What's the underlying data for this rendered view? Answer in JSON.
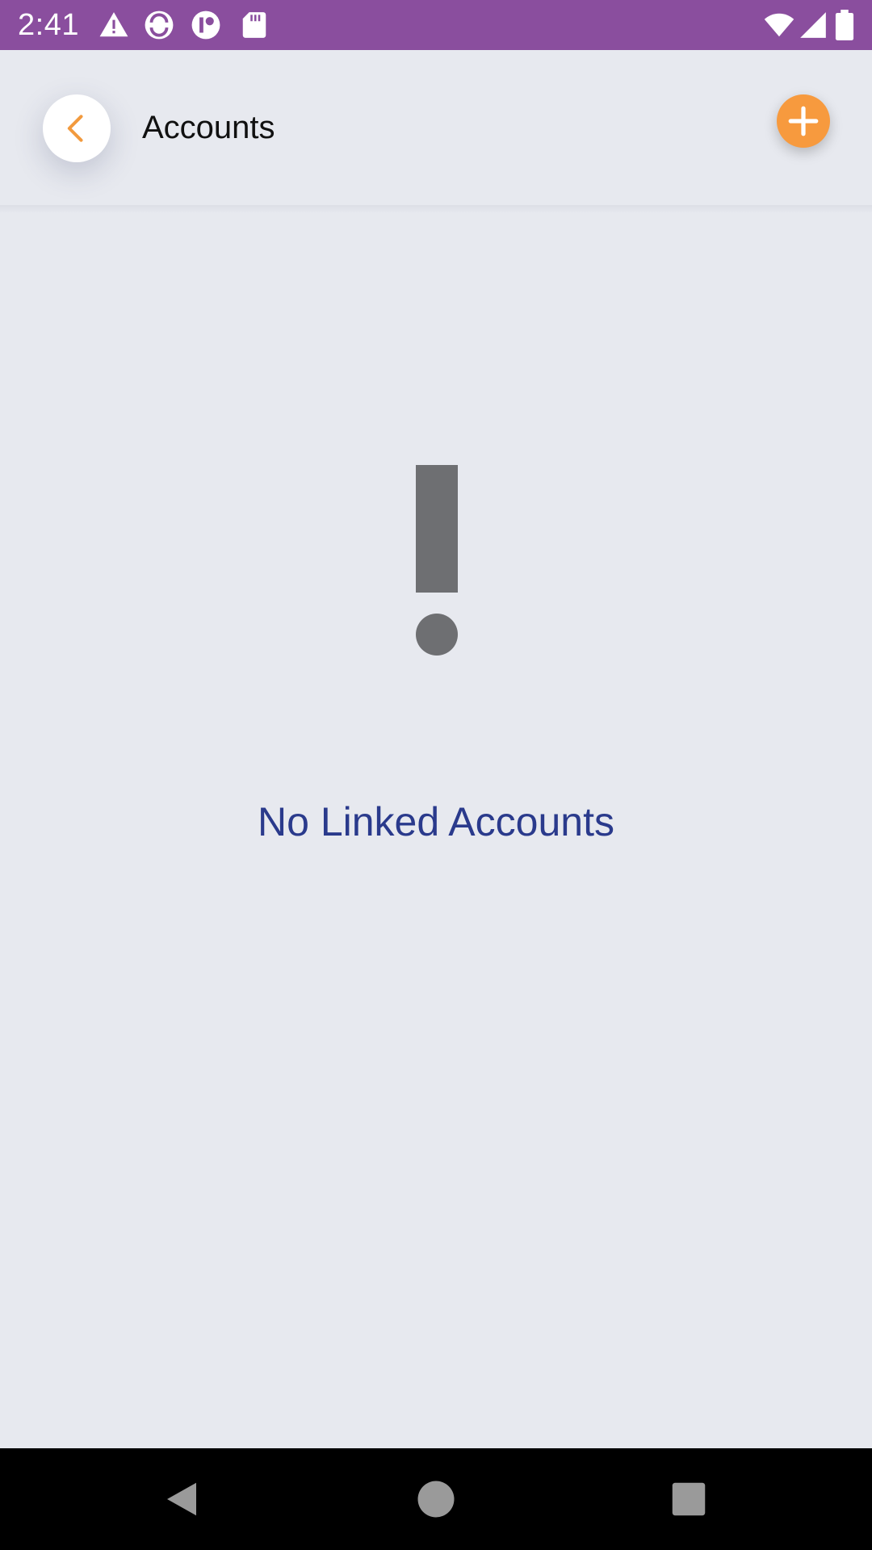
{
  "status_bar": {
    "time": "2:41",
    "background_color": "#8A4E9E",
    "icons": [
      "warning-icon",
      "sync-app-icon",
      "app-notification-icon",
      "sd-card-icon",
      "wifi-icon",
      "signal-icon",
      "battery-icon"
    ]
  },
  "header": {
    "title": "Accounts",
    "back_icon": "chevron-left-icon",
    "add_icon": "plus-icon",
    "accent_color": "#F79A3E"
  },
  "empty_state": {
    "icon": "exclamation-icon",
    "icon_color": "#6E6F72",
    "message": "No Linked Accounts",
    "message_color": "#2A3A8C"
  },
  "nav_bar": {
    "buttons": [
      "back-triangle-icon",
      "home-circle-icon",
      "recents-square-icon"
    ]
  }
}
